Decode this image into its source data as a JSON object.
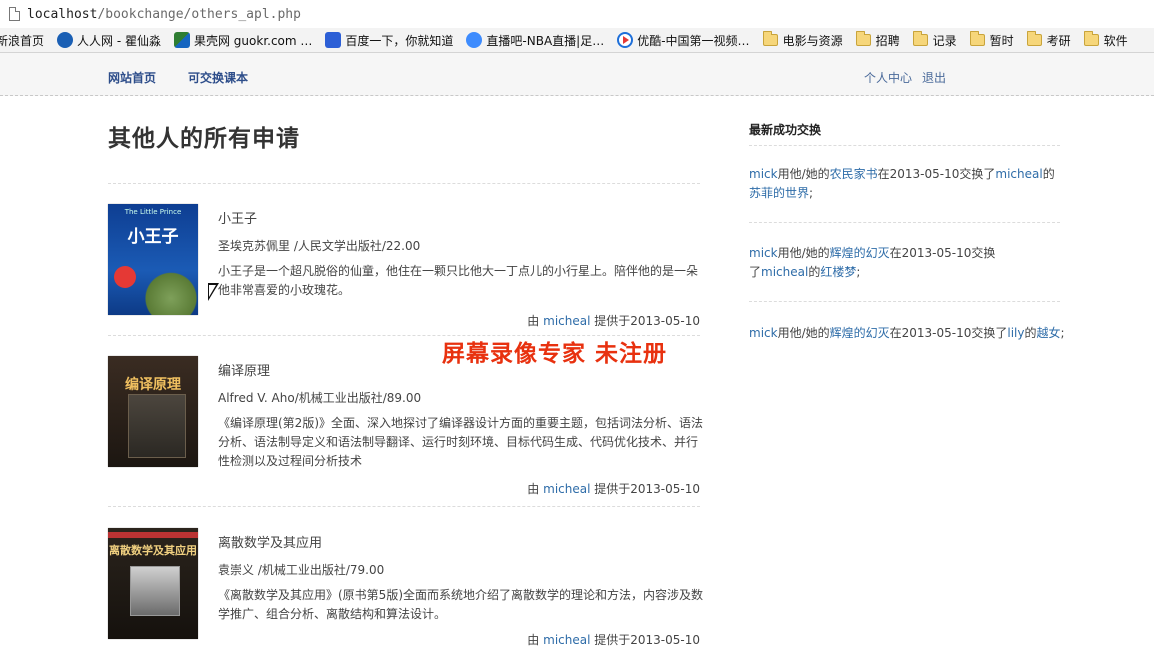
{
  "browser": {
    "url_host": "localhost",
    "url_path": "/bookchange/others_apl.php",
    "bookmarks": [
      {
        "label": "新浪首页",
        "icon": "none"
      },
      {
        "label": "人人网 - 瞿仙淼",
        "icon": "renren-icon"
      },
      {
        "label": "果壳网 guokr.com …",
        "icon": "guokr-icon"
      },
      {
        "label": "百度一下，你就知道",
        "icon": "baidu-icon"
      },
      {
        "label": "直播吧-NBA直播|足…",
        "icon": "zhibo-icon"
      },
      {
        "label": "优酷-中国第一视频…",
        "icon": "youku-icon"
      },
      {
        "label": "电影与资源",
        "icon": "folder-icon"
      },
      {
        "label": "招聘",
        "icon": "folder-icon"
      },
      {
        "label": "记录",
        "icon": "folder-icon"
      },
      {
        "label": "暂时",
        "icon": "folder-icon"
      },
      {
        "label": "考研",
        "icon": "folder-icon"
      },
      {
        "label": "软件",
        "icon": "folder-icon"
      }
    ]
  },
  "nav": {
    "home": "网站首页",
    "exchangeable": "可交换课本",
    "personal": "个人中心",
    "logout": "退出"
  },
  "main": {
    "title": "其他人的所有申请",
    "books": [
      {
        "title": "小王子",
        "meta": "圣埃克苏佩里 /人民文学出版社/22.00",
        "desc": "小王子是一个超凡脱俗的仙童，他住在一颗只比他大一丁点儿的小行星上。陪伴他的是一朵他非常喜爱的小玫瑰花。",
        "provided_prefix": "由",
        "user": "micheal",
        "provided_suffix": "提供于2013-05-10",
        "cover_title": "小王子",
        "cover_top": "The Little Prince"
      },
      {
        "title": "编译原理",
        "meta": "Alfred V. Aho/机械工业出版社/89.00",
        "desc": "《编译原理(第2版)》全面、深入地探讨了编译器设计方面的重要主题，包括词法分析、语法分析、语法制导定义和语法制导翻译、运行时刻环境、目标代码生成、代码优化技术、并行性检测以及过程间分析技术",
        "provided_prefix": "由",
        "user": "micheal",
        "provided_suffix": "提供于2013-05-10",
        "cover_title": "编译原理"
      },
      {
        "title": "离散数学及其应用",
        "meta": "袁崇义 /机械工业出版社/79.00",
        "desc": "《离散数学及其应用》(原书第5版)全面而系统地介绍了离散数学的理论和方法，内容涉及数学推广、组合分析、离散结构和算法设计。",
        "provided_prefix": "由",
        "user": "micheal",
        "provided_suffix": "提供于2013-05-10",
        "cover_title": "离散数学及其应用"
      }
    ]
  },
  "watermark": "屏幕录像专家  未注册",
  "sidebar": {
    "title": "最新成功交换",
    "items": [
      {
        "user1": "mick",
        "t1": "用他/她的",
        "book1": "农民家书",
        "t2": "在2013-05-10交换了",
        "user2": "micheal",
        "t3": "的",
        "book2": "苏菲的世界",
        "t4": ";"
      },
      {
        "user1": "mick",
        "t1": "用他/她的",
        "book1": "辉煌的幻灭",
        "t2": "在2013-05-10交换了",
        "user2": "micheal",
        "t3": "的",
        "book2": "红楼梦",
        "t4": ";"
      },
      {
        "user1": "mick",
        "t1": "用他/她的",
        "book1": "辉煌的幻灭",
        "t2": "在2013-05-10交换了",
        "user2": "lily",
        "t3": "的",
        "book2": "越女",
        "t4": ";"
      }
    ]
  }
}
